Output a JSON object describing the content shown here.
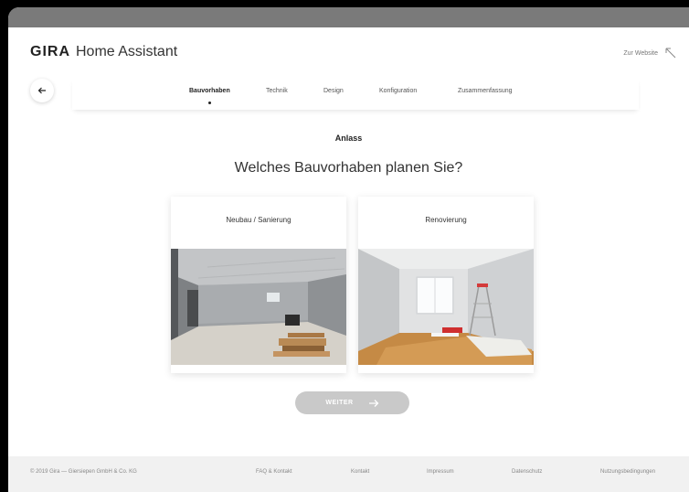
{
  "header": {
    "brand": "GIRA",
    "app_name": "Home Assistant",
    "website_link": "Zur Website"
  },
  "steps": [
    {
      "label": "Bauvorhaben",
      "active": true
    },
    {
      "label": "Technik",
      "active": false
    },
    {
      "label": "Design",
      "active": false
    },
    {
      "label": "Konfiguration",
      "active": false
    },
    {
      "label": "Zusammenfassung",
      "active": false
    }
  ],
  "main": {
    "section_label": "Anlass",
    "question": "Welches Bauvorhaben planen Sie?",
    "options": [
      {
        "title": "Neubau / Sanierung",
        "image": "construction-room-photo"
      },
      {
        "title": "Renovierung",
        "image": "renovated-room-photo"
      }
    ],
    "next_label": "WEITER"
  },
  "footer": {
    "copyright": "© 2019 Gira — Giersiepen GmbH & Co. KG",
    "links": [
      "FAQ & Kontakt",
      "Kontakt",
      "Impressum",
      "Datenschutz",
      "Nutzungsbedingungen"
    ]
  },
  "colors": {
    "device_bar": "#7a7a7a",
    "button_disabled": "#c9c9c9",
    "footer_bg": "#f1f1f1"
  },
  "icons": {
    "back": "arrow-left-icon",
    "website": "arrow-up-left-icon",
    "next": "arrow-right-icon"
  }
}
